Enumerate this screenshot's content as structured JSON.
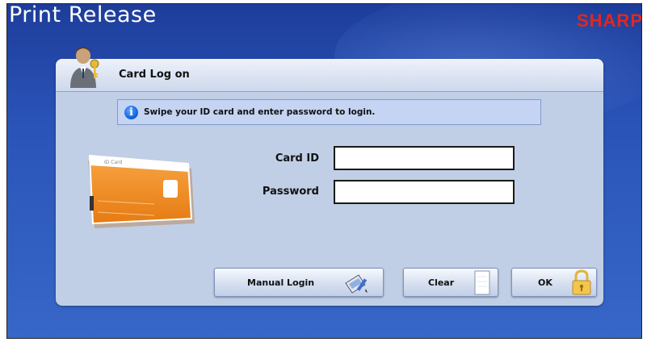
{
  "app": {
    "title": "Print Release",
    "brand": "SHARP"
  },
  "dialog": {
    "title": "Card Log on",
    "info_message": "Swipe your ID card and enter password to login.",
    "card_illustration_text": "ID Card"
  },
  "form": {
    "card_id_label": "Card ID",
    "card_id_value": "",
    "password_label": "Password",
    "password_value": ""
  },
  "buttons": {
    "manual_login": "Manual Login",
    "clear": "Clear",
    "ok": "OK"
  },
  "icons": {
    "avatar": "user-key-icon",
    "info": "info-icon",
    "manual_login": "card-pen-icon",
    "clear": "blank-page-icon",
    "ok": "padlock-icon"
  },
  "colors": {
    "background": "#2a53b8",
    "brand": "#e0281d",
    "dialog": "#c0cfe6",
    "info_bar": "#c4d4f2",
    "card": "#f08a1c"
  }
}
